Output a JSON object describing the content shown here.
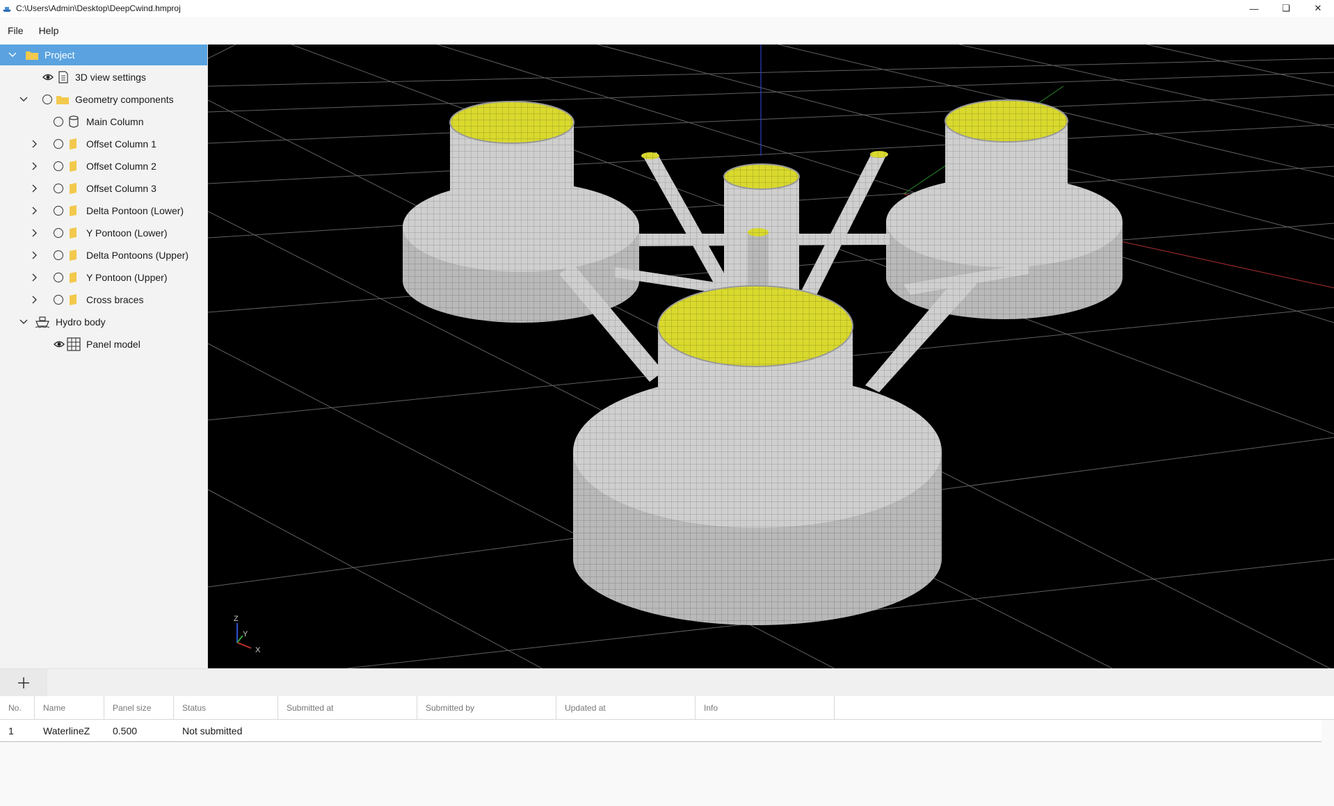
{
  "window": {
    "title": "C:\\Users\\Admin\\Desktop\\DeepCwind.hmproj",
    "app_icon": "ship-icon",
    "controls": [
      "minimize-icon",
      "restore-icon",
      "close-icon"
    ]
  },
  "menu": {
    "items": [
      "File",
      "Help"
    ]
  },
  "tree": {
    "items": [
      {
        "label": "Project",
        "icon": "folder-icon",
        "expanded": true,
        "selected": true
      },
      {
        "label": "3D view settings",
        "icon": "document-icon",
        "visible_toggle": "eye-icon"
      },
      {
        "label": "Geometry components",
        "icon": "folder-icon",
        "expanded": true
      },
      {
        "label": "Main Column",
        "icon": "cylinder-icon"
      },
      {
        "label": "Offset Column 1",
        "icon": "folder-icon",
        "collapsed": true
      },
      {
        "label": "Offset Column 2",
        "icon": "folder-icon",
        "collapsed": true
      },
      {
        "label": "Offset Column 3",
        "icon": "folder-icon",
        "collapsed": true
      },
      {
        "label": "Delta Pontoon (Lower)",
        "icon": "folder-icon",
        "collapsed": true
      },
      {
        "label": "Y Pontoon (Lower)",
        "icon": "folder-icon",
        "collapsed": true
      },
      {
        "label": "Delta Pontoons (Upper)",
        "icon": "folder-icon",
        "collapsed": true
      },
      {
        "label": "Y Pontoon (Upper)",
        "icon": "folder-icon",
        "collapsed": true
      },
      {
        "label": "Cross braces",
        "icon": "folder-icon",
        "collapsed": true
      },
      {
        "label": "Hydro body",
        "icon": "ship-icon",
        "expanded": true
      },
      {
        "label": "Panel model",
        "icon": "grid-icon",
        "visible_toggle": "eye-icon"
      }
    ]
  },
  "viewport": {
    "axes": {
      "z": "Z",
      "y": "Y",
      "x": "X"
    },
    "colors": {
      "background": "#000000",
      "mesh": "#c9c9c9",
      "interior": "#d8d82a",
      "grid": "#8a8a8a"
    }
  },
  "bottom": {
    "add_icon": "plus-icon",
    "columns": [
      "No.",
      "Name",
      "Panel size",
      "Status",
      "Submitted at",
      "Submitted by",
      "Updated at",
      "Info"
    ],
    "rows": [
      [
        "1",
        "WaterlineZ",
        "0.500",
        "Not submitted",
        "",
        "",
        "",
        ""
      ]
    ]
  }
}
